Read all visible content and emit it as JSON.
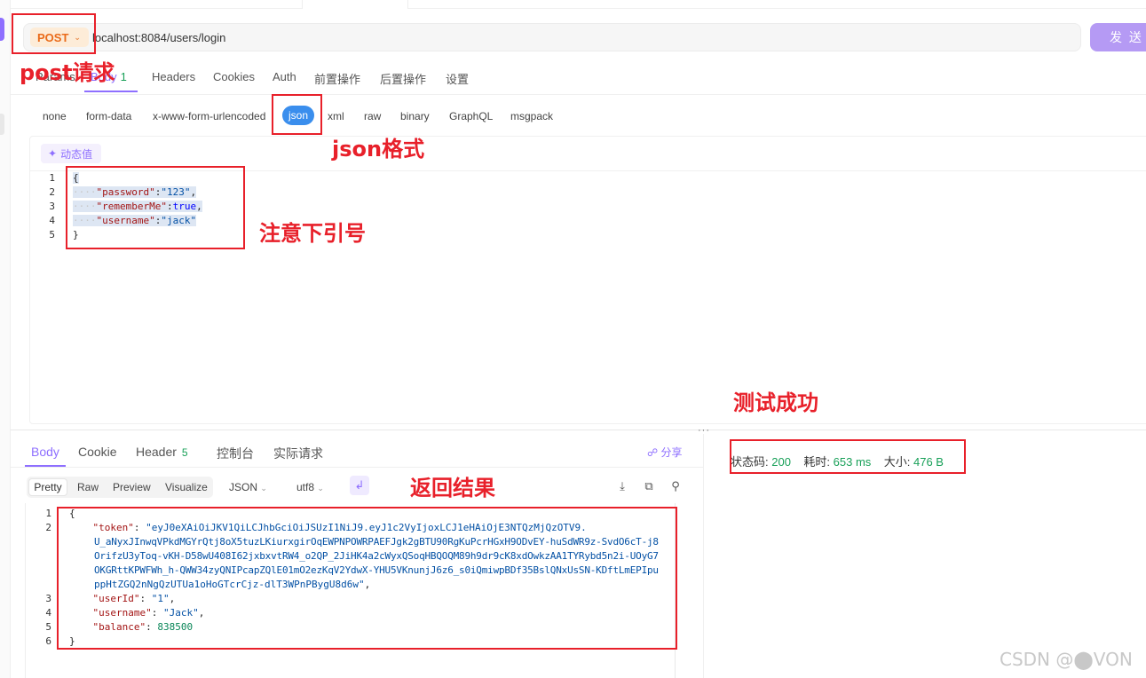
{
  "request": {
    "method": "POST",
    "url": "localhost:8084/users/login",
    "send_label": "发 送",
    "tabs": [
      {
        "label": "Params"
      },
      {
        "label": "Body",
        "count": "1"
      },
      {
        "label": "Headers"
      },
      {
        "label": "Cookies"
      },
      {
        "label": "Auth"
      },
      {
        "label": "前置操作"
      },
      {
        "label": "后置操作"
      },
      {
        "label": "设置"
      }
    ],
    "body_types": [
      "none",
      "form-data",
      "x-www-form-urlencoded",
      "json",
      "xml",
      "raw",
      "binary",
      "GraphQL",
      "msgpack"
    ],
    "selected_body_type": "json",
    "dynamic_value_label": "动态值",
    "code_lines": [
      "1",
      "2",
      "3",
      "4",
      "5"
    ],
    "code": {
      "open": "{",
      "password_key": "\"password\"",
      "password_val": "\"123\"",
      "remember_key": "\"rememberMe\"",
      "remember_val": "true",
      "username_key": "\"username\"",
      "username_val": "\"jack\"",
      "close": "}"
    }
  },
  "annotations": {
    "post": "post请求",
    "json": "json格式",
    "quotes": "注意下引号",
    "success": "测试成功",
    "result": "返回结果"
  },
  "response": {
    "tabs": [
      {
        "label": "Body"
      },
      {
        "label": "Cookie"
      },
      {
        "label": "Header",
        "count": "5"
      },
      {
        "label": "控制台"
      },
      {
        "label": "实际请求"
      }
    ],
    "share_label": "分享",
    "views": [
      "Pretty",
      "Raw",
      "Preview",
      "Visualize"
    ],
    "format": "JSON",
    "encoding": "utf8",
    "status": {
      "code_label": "状态码:",
      "code": "200",
      "time_label": "耗时:",
      "time": "653 ms",
      "size_label": "大小:",
      "size": "476 B"
    },
    "code_lines": [
      "1",
      "2",
      "3",
      "4",
      "5",
      "6"
    ],
    "code": {
      "open": "{",
      "token_key": "\"token\"",
      "token_val_1": "\"eyJ0eXAiOiJKV1QiLCJhbGciOiJSUzI1NiJ9.eyJ1c2VyIjoxLCJ1eHAiOjE3NTQzMjQzOTV9.",
      "token_val_2": "U_aNyxJInwqVPkdMGYrQtj8oX5tuzLKiurxgirOqEWPNPOWRPAEFJgk2gBTU90RgKuPcrHGxH9ODvEY-huSdWR9z-SvdO6cT-j8",
      "token_val_3": "OrifzU3yToq-vKH-D58wU408I62jxbxvtRW4_o2QP_2JiHK4a2cWyxQSoqHBQOQM89h9dr9cK8xdOwkzAA1TYRybd5n2i-UOyG7",
      "token_val_4": "OKGRttKPWFWh_h-QWW34zyQNIPcapZQlE01mO2ezKqV2YdwX-YHU5VKnunjJ6z6_s0iQmiwpBDf35BslQNxUsSN-KDftLmEPIpu",
      "token_val_5": "ppHtZGQ2nNgQzUTUa1oHoGTcrCjz-dlT3WPnPBygU8d6w\"",
      "userid_key": "\"userId\"",
      "userid_val": "\"1\"",
      "username_key": "\"username\"",
      "username_val": "\"Jack\"",
      "balance_key": "\"balance\"",
      "balance_val": "838500",
      "close": "}"
    }
  },
  "watermark": "CSDN @⬤VON",
  "colors": {
    "accent": "#8e6fff",
    "method": "#ea6b1a",
    "annotation": "#e8202a",
    "success": "#18a058",
    "json_pill": "#3a8eed"
  }
}
